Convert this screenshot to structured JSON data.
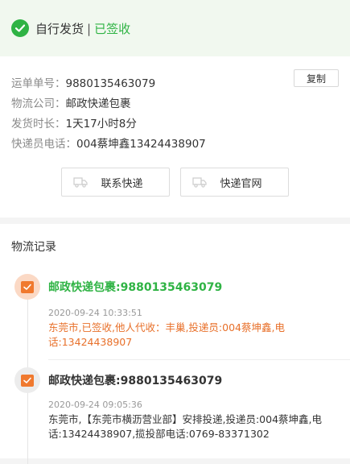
{
  "banner": {
    "label": "自行发货",
    "separator": "|",
    "status": "已签收"
  },
  "info": {
    "copy_label": "复制",
    "rows": [
      {
        "key": "运单单号：",
        "value": "9880135463079"
      },
      {
        "key": "物流公司：",
        "value": "邮政快递包裹"
      },
      {
        "key": "发货时长：",
        "value": "1天17小时8分"
      },
      {
        "key": "快递员电话：",
        "value": "004蔡坤鑫13424438907"
      }
    ],
    "contact_label": "联系快递",
    "website_label": "快递官网"
  },
  "records": {
    "title": "物流记录",
    "entries": [
      {
        "title": "邮政快递包裹:9880135463079",
        "time": "2020-09-24 10:33:51",
        "desc": "东莞市,已签收,他人代收：丰巢,投递员:004蔡坤鑫,电话:13424438907"
      },
      {
        "title": "邮政快递包裹:9880135463079",
        "time": "2020-09-24 09:05:36",
        "desc": "东莞市,【东莞市横沥营业部】安排投递,投递员:004蔡坤鑫,电话:13424438907,揽投部电话:0769-83371302"
      }
    ]
  },
  "colors": {
    "accent_green": "#2fb344",
    "accent_orange": "#f0792e"
  }
}
